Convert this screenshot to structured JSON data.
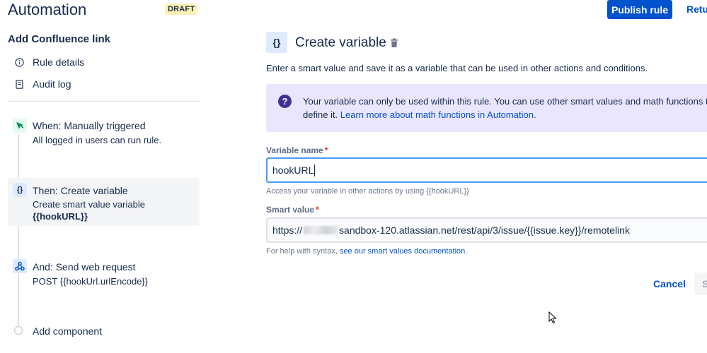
{
  "header": {
    "title": "Automation",
    "badge": "DRAFT",
    "publish_label": "Publish rule",
    "return_label": "Return"
  },
  "sidebar": {
    "rule_name": "Add Confluence link",
    "links": [
      {
        "label": "Rule details",
        "icon": "info-icon"
      },
      {
        "label": "Audit log",
        "icon": "document-icon"
      }
    ],
    "steps": [
      {
        "title": "When: Manually triggered",
        "desc": "All logged in users can run rule.",
        "icon": "trigger-cursor-icon",
        "color": "#36b37e"
      },
      {
        "title": "Then: Create variable",
        "desc": "Create smart value variable",
        "value": "{{hookURL}}",
        "icon": "braces-icon",
        "color": "#0052cc"
      },
      {
        "title": "And: Send web request",
        "desc": "POST {{hookUrl.urlEncode}}",
        "icon": "webhook-icon",
        "color": "#0065ff"
      }
    ],
    "add_component": "Add component"
  },
  "panel": {
    "icon": "{}",
    "title": "Create variable",
    "description": "Enter a smart value and save it as a variable that can be used in other actions and conditions.",
    "info_line1": "Your variable can only be used within this rule. You can use other smart values and math functions to",
    "info_line2_prefix": "define it. ",
    "info_link": "Learn more about math functions in Automation",
    "info_line2_suffix": ".",
    "variable_name_label": "Variable name",
    "variable_name_value": "hookURL",
    "variable_name_help": "Access your variable in other actions by using {{hookURL}}",
    "smart_value_label": "Smart value",
    "smart_value_prefix": "https://",
    "smart_value_suffix": "sandbox-120.atlassian.net/rest/api/3/issue/{{issue.key}}/remotelink",
    "smart_value_help_prefix": "For help with syntax, ",
    "smart_value_help_link": "see our smart values documentation",
    "smart_value_help_suffix": ".",
    "cancel_label": "Cancel",
    "save_label": "Save"
  },
  "colors": {
    "primary": "#0052cc",
    "info_bg": "#eae6ff",
    "info_icon": "#403294",
    "required": "#de350b"
  }
}
